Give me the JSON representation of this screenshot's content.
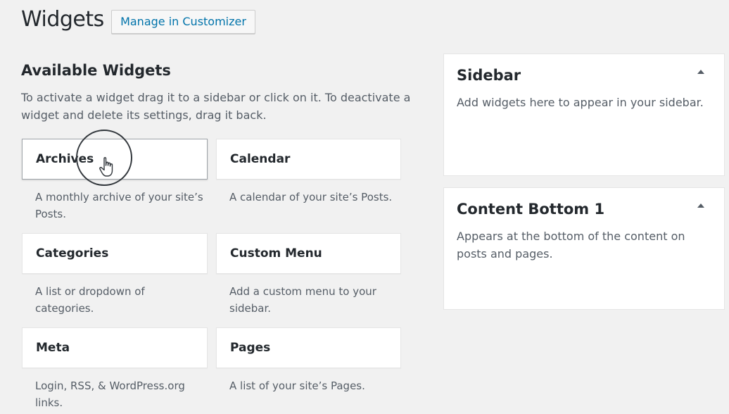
{
  "header": {
    "title": "Widgets",
    "customizer_label": "Manage in Customizer"
  },
  "available": {
    "title": "Available Widgets",
    "description": "To activate a widget drag it to a sidebar or click on it. To deactivate a widget and delete its settings, drag it back."
  },
  "widgets": [
    {
      "name": "Archives",
      "description": "A monthly archive of your site’s Posts."
    },
    {
      "name": "Calendar",
      "description": "A calendar of your site’s Posts."
    },
    {
      "name": "Categories",
      "description": "A list or dropdown of categories."
    },
    {
      "name": "Custom Menu",
      "description": "Add a custom menu to your sidebar."
    },
    {
      "name": "Meta",
      "description": "Login, RSS, & WordPress.org links."
    },
    {
      "name": "Pages",
      "description": "A list of your site’s Pages."
    }
  ],
  "sidebars": [
    {
      "title": "Sidebar",
      "description": "Add widgets here to appear in your sidebar."
    },
    {
      "title": "Content Bottom 1",
      "description": "Appears at the bottom of the content on posts and pages."
    }
  ],
  "icons": {
    "toggle": "arrow-up-icon",
    "cursor": "hand-pointer-icon"
  },
  "colors": {
    "background": "#f1f1f1",
    "card": "#ffffff",
    "link": "#0073aa",
    "text": "#23282d",
    "muted": "#555d66"
  }
}
